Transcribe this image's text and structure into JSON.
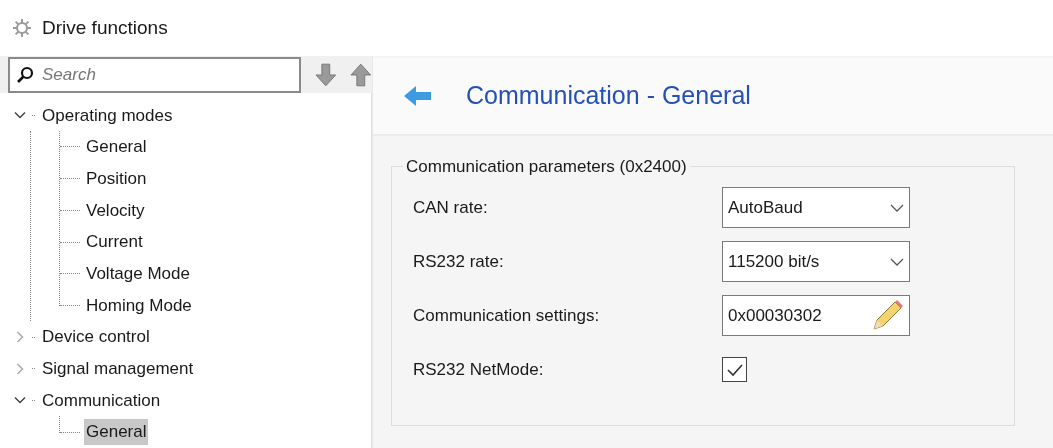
{
  "window": {
    "title": "Drive functions"
  },
  "search": {
    "placeholder": "Search"
  },
  "tree": [
    {
      "label": "Operating modes",
      "expanded": true,
      "selected": false,
      "children": [
        {
          "label": "General",
          "selected": false
        },
        {
          "label": "Position",
          "selected": false
        },
        {
          "label": "Velocity",
          "selected": false
        },
        {
          "label": "Current",
          "selected": false
        },
        {
          "label": "Voltage Mode",
          "selected": false
        },
        {
          "label": "Homing Mode",
          "selected": false
        }
      ]
    },
    {
      "label": "Device control",
      "expanded": false,
      "selected": false
    },
    {
      "label": "Signal management",
      "expanded": false,
      "selected": false
    },
    {
      "label": "Communication",
      "expanded": true,
      "selected": false,
      "children": [
        {
          "label": "General",
          "selected": true
        }
      ]
    }
  ],
  "page": {
    "title": "Communication - General"
  },
  "group": {
    "title": "Communication parameters (0x2400)",
    "fields": [
      {
        "kind": "dropdown",
        "label": "CAN rate:",
        "value": "AutoBaud"
      },
      {
        "kind": "dropdown",
        "label": "RS232 rate:",
        "value": "115200 bit/s"
      },
      {
        "kind": "edit",
        "label": "Communication settings:",
        "value": "0x00030302"
      },
      {
        "kind": "checkbox",
        "label": "RS232 NetMode:",
        "checked": true
      }
    ]
  }
}
